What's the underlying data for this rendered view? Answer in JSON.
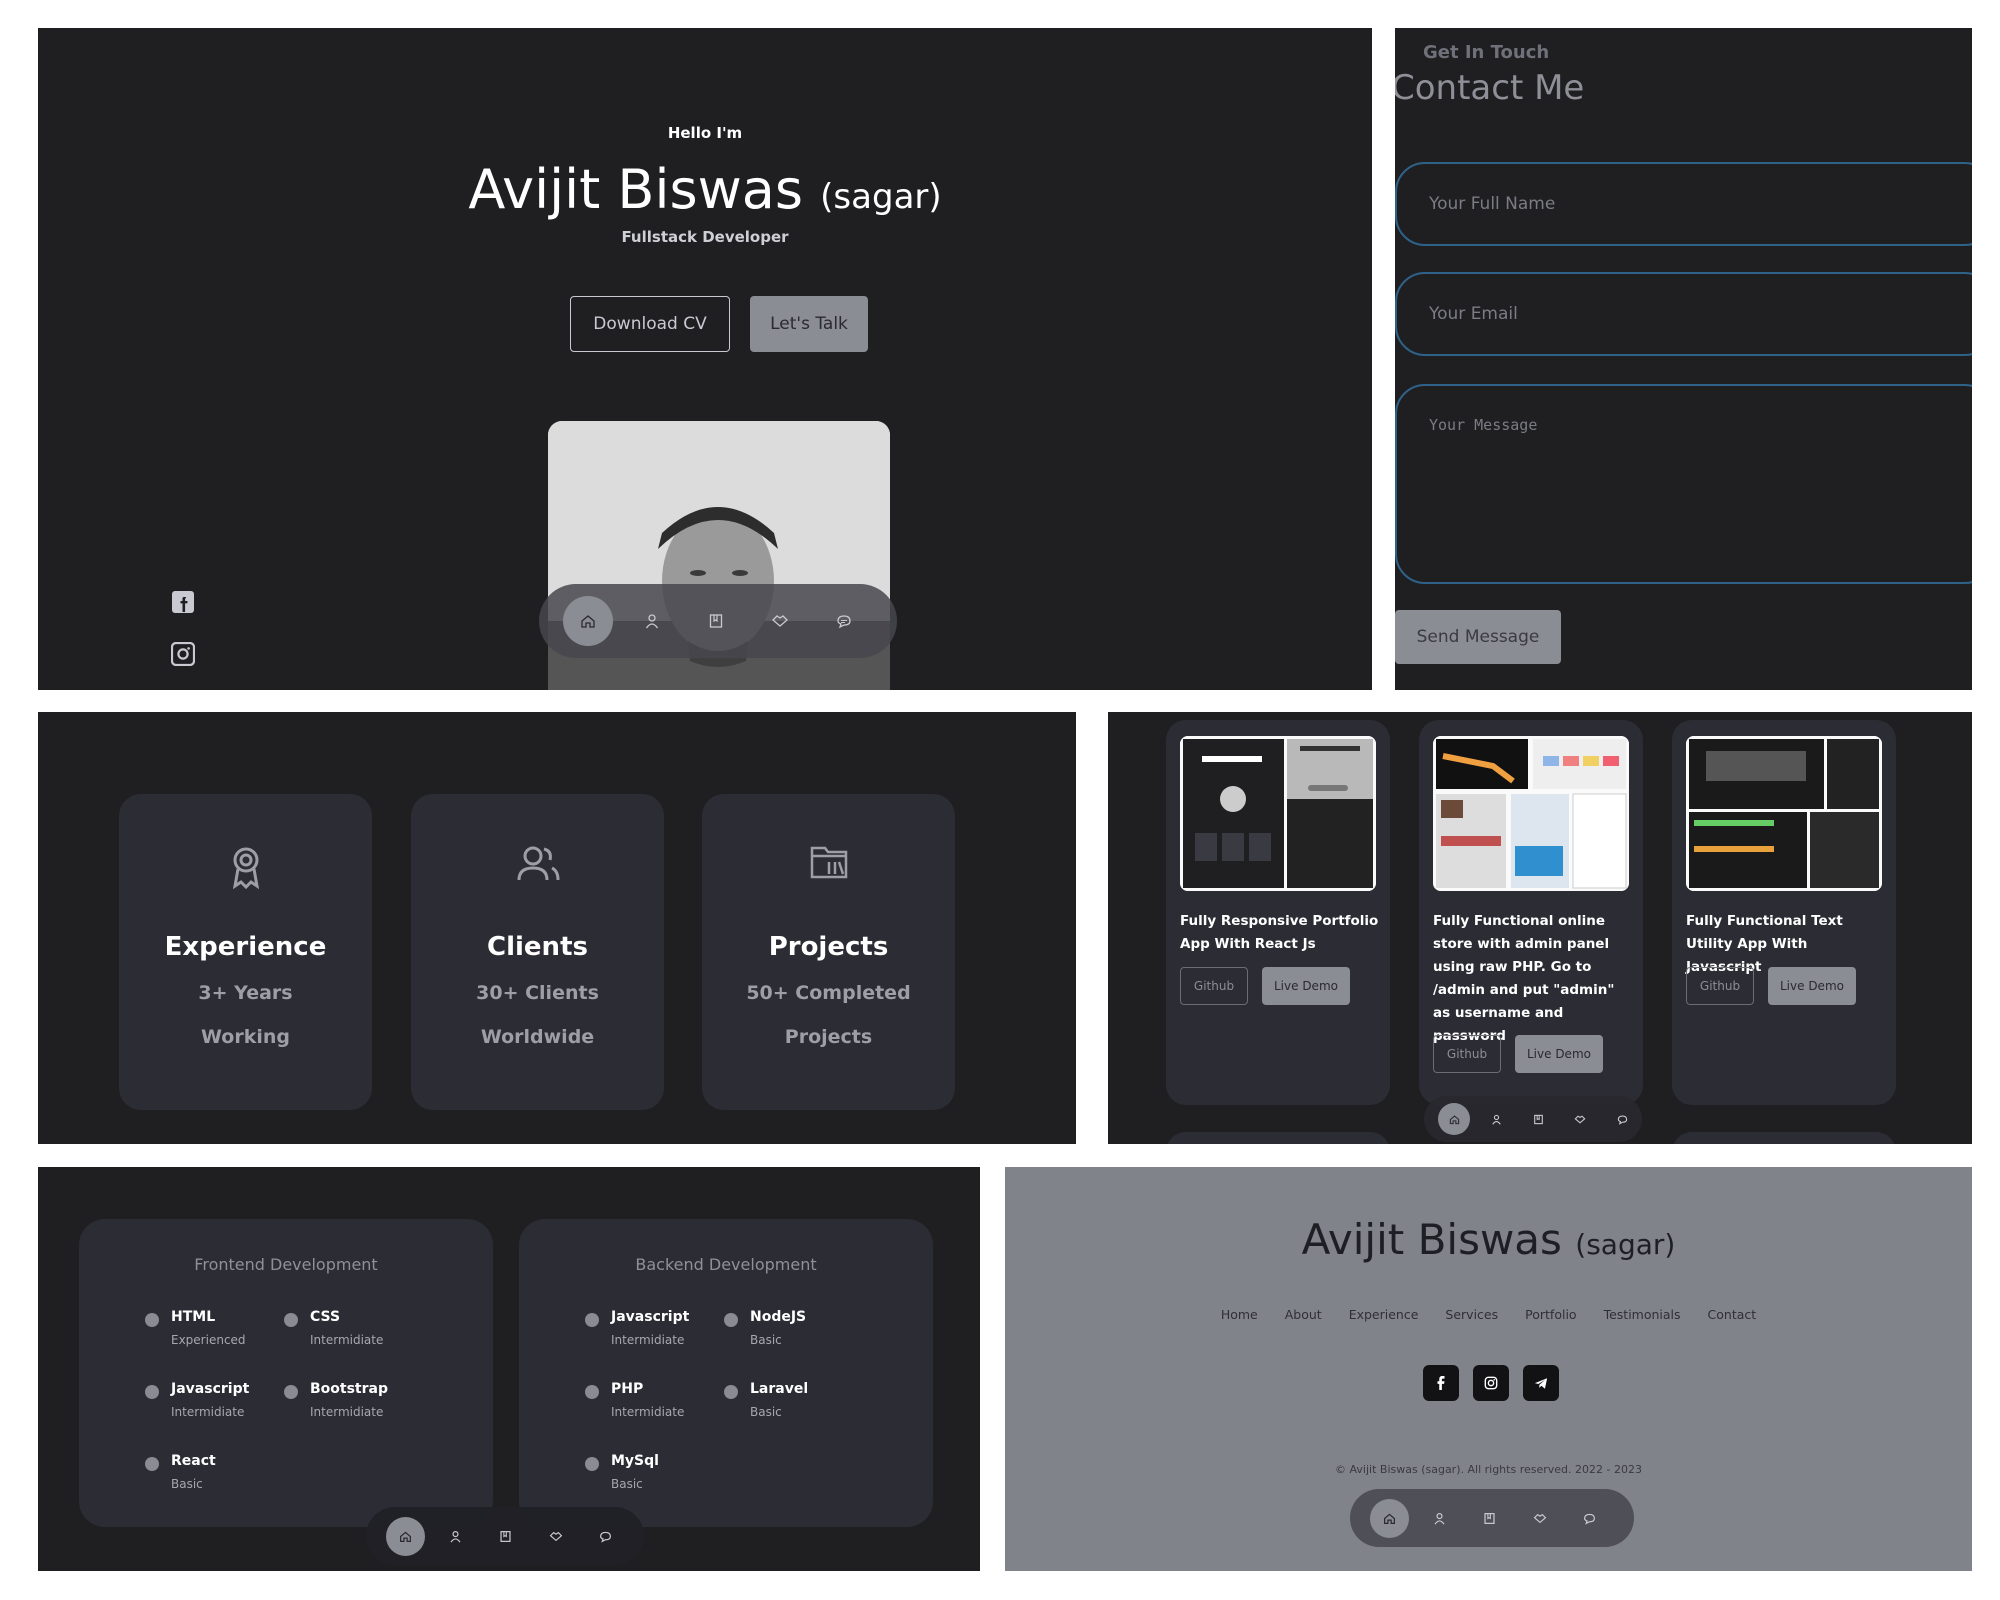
{
  "hero": {
    "hello": "Hello I'm",
    "name": "Avijit Biswas",
    "nickname": "(sagar)",
    "role": "Fullstack Developer",
    "download_label": "Download CV",
    "talk_label": "Let's Talk"
  },
  "contact": {
    "subtitle": "Get In Touch",
    "title": "Contact Me",
    "name_placeholder": "Your Full Name",
    "email_placeholder": "Your Email",
    "message_placeholder": "Your Message",
    "send_label": "Send Message"
  },
  "stats": [
    {
      "title": "Experience",
      "line1": "3+ Years",
      "line2": "Working",
      "icon": "award-icon"
    },
    {
      "title": "Clients",
      "line1": "30+ Clients",
      "line2": "Worldwide",
      "icon": "users-icon"
    },
    {
      "title": "Projects",
      "line1": "50+ Completed",
      "line2": "Projects",
      "icon": "folder-icon"
    }
  ],
  "portfolio": [
    {
      "title": "Fully Responsive Portfolio App With React Js",
      "github": "Github",
      "demo": "Live Demo"
    },
    {
      "title": "Fully Functional online store with admin panel using raw PHP. Go to /admin and put \"admin\" as username and password",
      "github": "Github",
      "demo": "Live Demo"
    },
    {
      "title": "Fully Functional Text Utility App With Javascript",
      "github": "Github",
      "demo": "Live Demo"
    }
  ],
  "skills": {
    "frontend": {
      "title": "Frontend Development",
      "items": [
        {
          "name": "HTML",
          "level": "Experienced"
        },
        {
          "name": "CSS",
          "level": "Intermidiate"
        },
        {
          "name": "Javascript",
          "level": "Intermidiate"
        },
        {
          "name": "Bootstrap",
          "level": "Intermidiate"
        },
        {
          "name": "React",
          "level": "Basic"
        }
      ]
    },
    "backend": {
      "title": "Backend Development",
      "items": [
        {
          "name": "Javascript",
          "level": "Intermidiate"
        },
        {
          "name": "NodeJS",
          "level": "Basic"
        },
        {
          "name": "PHP",
          "level": "Intermidiate"
        },
        {
          "name": "Laravel",
          "level": "Basic"
        },
        {
          "name": "MySql",
          "level": "Basic"
        }
      ]
    }
  },
  "footer": {
    "name": "Avijit Biswas",
    "nickname": "(sagar)",
    "links": [
      "Home",
      "About",
      "Experience",
      "Services",
      "Portfolio",
      "Testimonials",
      "Contact"
    ],
    "copyright": "© Avijit Biswas (sagar). All rights reserved. 2022 - 2023"
  },
  "nav_icons": [
    "home-icon",
    "user-icon",
    "book-icon",
    "services-icon",
    "message-icon"
  ],
  "colors": {
    "background": "#1f1f22",
    "card": "#2c2c34",
    "accent": "#8a8d93",
    "footer_bg": "#80838a",
    "input_border": "#2e6288"
  }
}
